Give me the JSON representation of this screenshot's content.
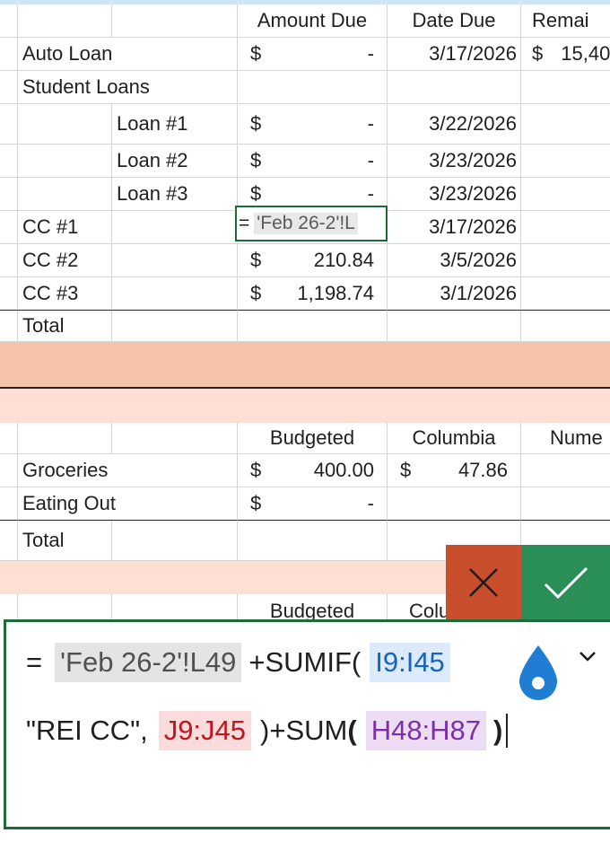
{
  "colors": {
    "accent": "#1e6b3a",
    "cancel": "#c94f2c",
    "confirm": "#2a8f57",
    "band_dark": "#f5c4a8",
    "band_light": "#fde0d3",
    "ref_blue": "#1565c0",
    "ref_red": "#c0161d",
    "ref_purple": "#7b2fa8"
  },
  "header1": {
    "amount_due": "Amount Due",
    "date_due": "Date Due",
    "remaining": "Remai"
  },
  "bills": [
    {
      "label": "Auto Loan",
      "cur": "$",
      "amount": "-",
      "date": "3/17/2026",
      "rem_cur": "$",
      "remaining": "15,40"
    },
    {
      "label": "Student Loans"
    },
    {
      "label": "Loan #1",
      "cur": "$",
      "amount": "-",
      "date": "3/22/2026"
    },
    {
      "label": "Loan #2",
      "cur": "$",
      "amount": "-",
      "date": "3/23/2026"
    },
    {
      "label": "Loan #3",
      "cur": "$",
      "amount": "-",
      "date": "3/23/2026"
    },
    {
      "label": "CC #1",
      "date": "3/17/2026"
    },
    {
      "label": "CC #2",
      "cur": "$",
      "amount": "210.84",
      "date": "3/5/2026"
    },
    {
      "label": "CC #3",
      "cur": "$",
      "amount": "1,198.74",
      "date": "3/1/2026"
    },
    {
      "label": "Total"
    }
  ],
  "editing_cell": {
    "eq": "=",
    "ref": "'Feb   26-2'!L"
  },
  "header2": {
    "budgeted": "Budgeted",
    "columbia": "Columbia",
    "nume": "Nume"
  },
  "budget": [
    {
      "label": "Groceries",
      "cur": "$",
      "budgeted": "400.00",
      "col_cur": "$",
      "columbia": "47.86"
    },
    {
      "label": "Eating Out",
      "cur": "$",
      "budgeted": "-"
    },
    {
      "label": "Total"
    }
  ],
  "header3": {
    "budgeted": "Budgeted",
    "columbia": "Colu"
  },
  "formula": {
    "eq": "=",
    "sheet_ref": "'Feb   26-2'!L49",
    "sumif": "+SUMIF(",
    "range1": "I9:I45",
    "criteria": "\"REI CC\",",
    "range2": "J9:J45",
    "mid": ")+SUM",
    "open_paren": "(",
    "range3": "H48:H87",
    "close_paren": ")"
  },
  "icons": {
    "cancel": "close-icon",
    "confirm": "checkmark-icon",
    "expand": "chevron-down-icon",
    "handle": "selection-handle-icon"
  }
}
